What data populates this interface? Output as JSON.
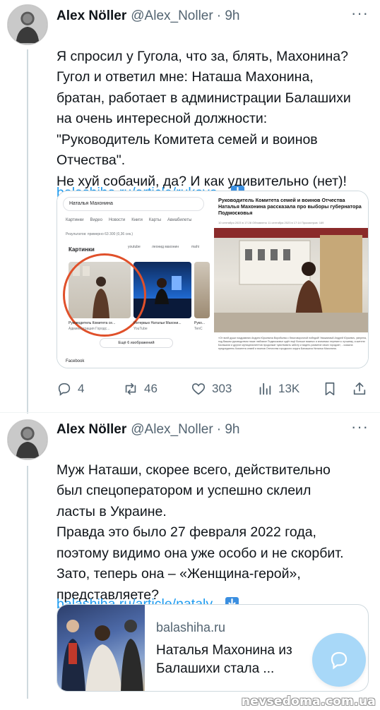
{
  "tweets": [
    {
      "author": "Alex Nöller",
      "handle": "@Alex_Noller",
      "time": "· 9h",
      "more": "···",
      "text": "Я спросил у Гугола, что за, блять, Махонина?\nГугол и ответил мне: Наташа Махонина,\nбратан, работает в администрации Балашихи\nна очень интересной должности:\n\"Руководитель Комитета семей и воинов\nОтчества\".\nНе хуй собачий, да? И как удивительно (нет)!",
      "link": "balashiha.ru/article/rukovo...",
      "media": {
        "search_query": "Наталья Махонина",
        "tabs": [
          "Картинки",
          "Видео",
          "Новости",
          "Книги",
          "Карты",
          "Авиабилеты"
        ],
        "results_count": "Результатов: примерно 63 300 (0,36 сек.)",
        "images_label": "Картинки",
        "chips": [
          "youtube",
          "леонид махонин",
          "mahi"
        ],
        "captions": [
          "Руководитель Комитета се...",
          "Интервью Натальи Махони...",
          "Руко..."
        ],
        "caption_sources": [
          "Администрация Городс...",
          "YouTube",
          "TenC"
        ],
        "more_images": "Ещё 6 изображений",
        "facebook": "Facebook",
        "news_title": "Руководитель Комитета семей и воинов Отчества Наталья Махонина рассказала про выборы губернатора Подмосковья",
        "news_meta": "10 сентября 2023 в 17:28   Обновлено 11 сентября 2023 в 17:14                 Просмотров: 169",
        "news_body": "«От всей души поздравляю Андрея Юрьевича Воробьева с безоговорочной победой! Уважаемый Андрей Юрьевич, уверена, под Вашим руководством наше любимое Подмосковье ждёт ещё больше важных и значимых перемен к лучшему, а жители Балашихи и другие муниципалитетов продолжат чувствовать заботу и видеть развитие своих городов», - сказала председатель Комитета семей и воинов Отечества городского округа Балашиха Наталья Махонина."
      },
      "stats": {
        "replies": "4",
        "retweets": "46",
        "likes": "303",
        "views": "13K"
      }
    },
    {
      "author": "Alex Nöller",
      "handle": "@Alex_Noller",
      "time": "· 9h",
      "more": "···",
      "text": "Муж Наташи, скорее всего, действительно\nбыл спецоператором и успешно склеил\nласты в Украине.\nПравда это было 27 февраля 2022 года,\nпоэтому видимо она уже особо и не скорбит.\nЗато, теперь она – «Женщина-герой»,\nпредставляете?",
      "link": "balashiha.ru/article/nataly...",
      "card": {
        "domain": "balashiha.ru",
        "title": "Наталья Махонина из\nБалашихи стала ..."
      }
    }
  ],
  "watermark": "nevsedoma.com.ua",
  "colors": {
    "link": "#1d9bf0",
    "muted": "#536471",
    "fab": "#a8d8f8",
    "ring": "#e0502a"
  }
}
